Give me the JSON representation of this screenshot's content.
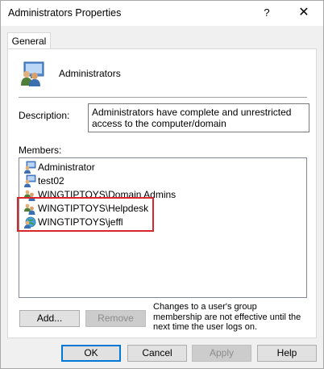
{
  "window": {
    "title": "Administrators Properties",
    "help_glyph": "?",
    "close_glyph": "✕"
  },
  "tabs": [
    {
      "label": "General",
      "active": true
    }
  ],
  "group": {
    "name": "Administrators",
    "icon": "group-users-icon"
  },
  "description": {
    "label": "Description:",
    "value": "Administrators have complete and unrestricted access to the computer/domain"
  },
  "members": {
    "label": "Members:",
    "items": [
      {
        "name": "Administrator",
        "icon": "user-icon"
      },
      {
        "name": "test02",
        "icon": "user-icon"
      },
      {
        "name": "WINGTIPTOYS\\Domain Admins",
        "icon": "group-icon"
      },
      {
        "name": "WINGTIPTOYS\\Helpdesk",
        "icon": "group-icon"
      },
      {
        "name": "WINGTIPTOYS\\jeffl",
        "icon": "user-globe-icon"
      }
    ],
    "highlighted": [
      "WINGTIPTOYS\\Helpdesk",
      "WINGTIPTOYS\\jeffl"
    ],
    "highlight_color": "#d9262c"
  },
  "actions": {
    "add_label": "Add...",
    "remove_label": "Remove",
    "note": "Changes to a user's group membership are not effective until the next time the user logs on."
  },
  "footer": {
    "ok_label": "OK",
    "cancel_label": "Cancel",
    "apply_label": "Apply",
    "help_label": "Help"
  },
  "colors": {
    "focus_blue": "#0078d7",
    "window_bg": "#f0f0f0"
  }
}
